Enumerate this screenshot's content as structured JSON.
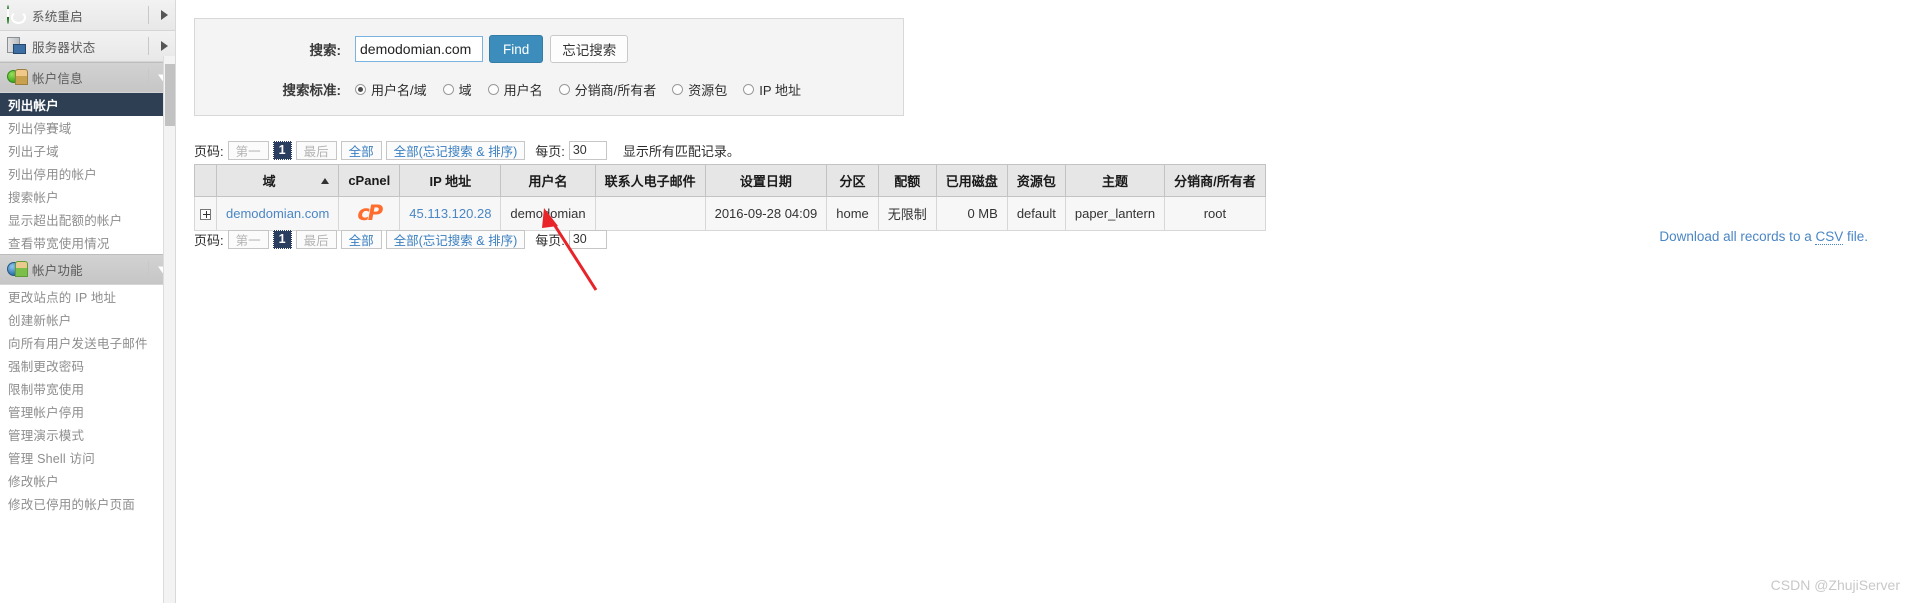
{
  "sidebar": {
    "groups": [
      {
        "icon": "power-icon",
        "label": "系统重启",
        "state": "collapsed",
        "arrow": "chevron-right-icon"
      },
      {
        "icon": "server-status-icon",
        "label": "服务器状态",
        "state": "collapsed",
        "arrow": "chevron-right-icon"
      },
      {
        "icon": "account-info-icon",
        "label": "帐户信息",
        "state": "expanded",
        "arrow": "chevron-down-icon"
      },
      {
        "icon": "account-functions-icon",
        "label": "帐户功能",
        "state": "expanded",
        "arrow": "chevron-down-icon"
      }
    ],
    "account_info_items": [
      {
        "label": "列出帐户",
        "selected": true
      },
      {
        "label": "列出停賽域",
        "selected": false
      },
      {
        "label": "列出子域",
        "selected": false
      },
      {
        "label": "列出停用的帐户",
        "selected": false
      },
      {
        "label": "搜索帐户",
        "selected": false
      },
      {
        "label": "显示超出配额的帐户",
        "selected": false
      },
      {
        "label": "查看带宽使用情况",
        "selected": false
      }
    ],
    "account_functions_items": [
      {
        "label": "更改站点的 IP 地址"
      },
      {
        "label": "创建新帐户"
      },
      {
        "label": "向所有用户发送电子邮件"
      },
      {
        "label": "强制更改密码"
      },
      {
        "label": "限制带宽使用"
      },
      {
        "label": "管理帐户停用"
      },
      {
        "label": "管理演示模式"
      },
      {
        "label": "管理 Shell 访问"
      },
      {
        "label": "修改帐户"
      },
      {
        "label": "修改已停用的帐户页面"
      }
    ]
  },
  "search": {
    "label": "搜索:",
    "value": "demodomian.com",
    "placeholder": "",
    "find_label": "Find",
    "forget_label": "忘记搜索",
    "criteria_label": "搜索标准:",
    "criteria_options": [
      {
        "label": "用户名/域",
        "selected": true
      },
      {
        "label": "域",
        "selected": false
      },
      {
        "label": "用户名",
        "selected": false
      },
      {
        "label": "分销商/所有者",
        "selected": false
      },
      {
        "label": "资源包",
        "selected": false
      },
      {
        "label": "IP 地址",
        "selected": false
      }
    ]
  },
  "pager": {
    "page_label": "页码:",
    "first_label": "第一",
    "current_page": "1",
    "last_label": "最后",
    "all_label": "全部",
    "all_reset_label": "全部(忘记搜索 & 排序)",
    "per_page_label": "每页:",
    "per_page_value": "30",
    "all_matching_label": "显示所有匹配记录。"
  },
  "csv": {
    "prefix": "Download all records to a ",
    "dotted": "CSV",
    "suffix": " file."
  },
  "table": {
    "columns": [
      "域",
      "cPanel",
      "IP 地址",
      "用户名",
      "联系人电子邮件",
      "设置日期",
      "分区",
      "配额",
      "已用磁盘",
      "资源包",
      "主题",
      "分销商/所有者"
    ],
    "sort_column": "域",
    "sort_direction": "asc",
    "rows": [
      {
        "expand": "expand-icon",
        "domain": "demodomian.com",
        "cpanel": "cP",
        "ip": "45.113.120.28",
        "user": "demodomian",
        "email": "",
        "setup_date": "2016-09-28 04:09",
        "partition": "home",
        "quota": "无限制",
        "disk_used": "0 MB",
        "package": "default",
        "theme": "paper_lantern",
        "owner": "root"
      }
    ]
  },
  "watermark": "CSDN @ZhujiServer",
  "colors": {
    "accent_blue": "#3c8dbc",
    "link_blue": "#4a86c5",
    "selected_navy": "#2e3f54",
    "cpanel_orange": "#ff6c2c",
    "annotation_red": "#e8232a"
  }
}
